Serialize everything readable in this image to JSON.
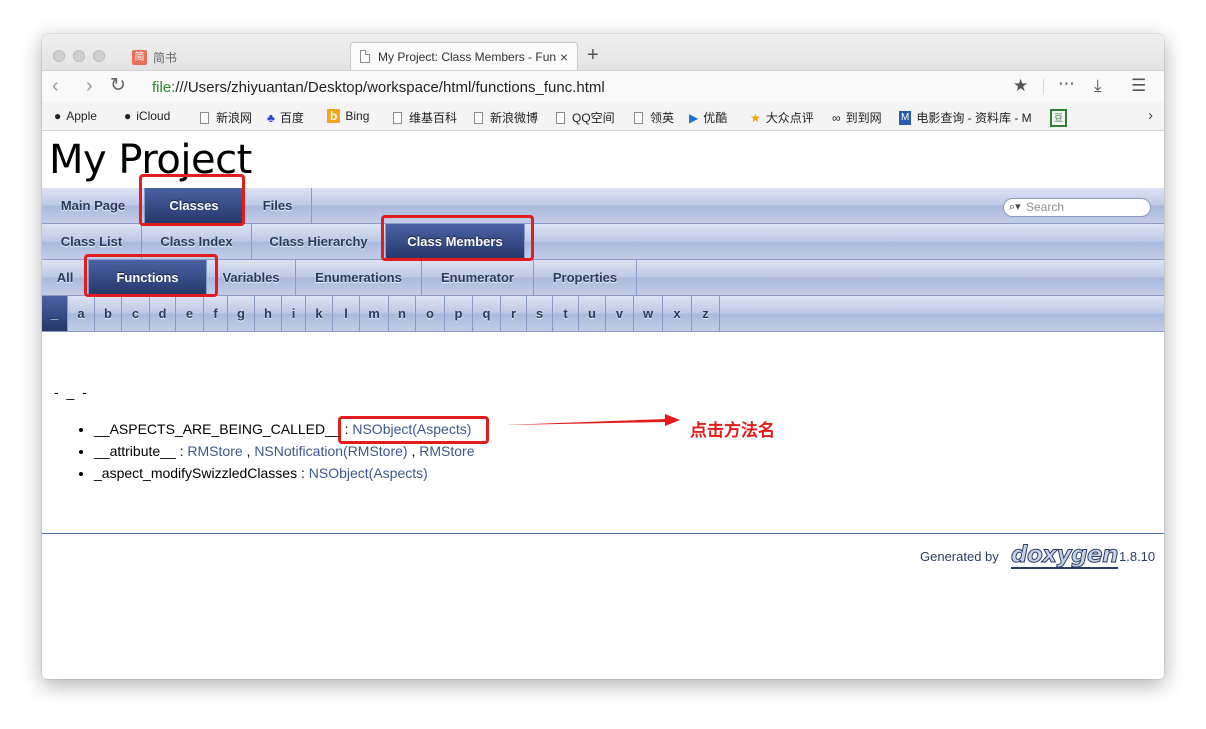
{
  "browser": {
    "tabs": [
      {
        "title": "简书",
        "icon_text": "简"
      },
      {
        "title": "My Project: Class Members - Function",
        "close": "×"
      }
    ],
    "new_tab": "+",
    "url_scheme": "file:",
    "url_path": "///Users/zhiyuantan/Desktop/workspace/html/functions_func.html",
    "icons": {
      "back": "back-icon",
      "forward": "forward-icon",
      "reload": "reload-icon",
      "bookmark": "star-icon",
      "more": "more-icon",
      "download": "download-icon",
      "menu": "hamburger-icon"
    },
    "bookmarks": [
      "Apple",
      "iCloud",
      "新浪网",
      "百度",
      "Bing",
      "维基百科",
      "新浪微博",
      "QQ空间",
      "领英",
      "优酷",
      "大众点评",
      "到到网",
      "电影查询 - 资料库 - M",
      ""
    ],
    "bookmarks_more": "›"
  },
  "doxygen": {
    "project_name": "My Project",
    "nav_main": [
      "Main Page",
      "Classes",
      "Files"
    ],
    "search_placeholder": "Search",
    "nav_classes": [
      "Class List",
      "Class Index",
      "Class Hierarchy",
      "Class Members"
    ],
    "nav_members": [
      "All",
      "Functions",
      "Variables",
      "Enumerations",
      "Enumerator",
      "Properties"
    ],
    "letters": [
      "_",
      "a",
      "b",
      "c",
      "d",
      "e",
      "f",
      "g",
      "h",
      "i",
      "k",
      "l",
      "m",
      "n",
      "o",
      "p",
      "q",
      "r",
      "s",
      "t",
      "u",
      "v",
      "w",
      "x",
      "z"
    ],
    "section_heading": "- _ -",
    "members": [
      {
        "name": "__ASPECTS_ARE_BEING_CALLED__",
        "sep": " : ",
        "links": [
          "NSObject(Aspects)"
        ]
      },
      {
        "name": "__attribute__",
        "sep": " : ",
        "links": [
          "RMStore",
          "NSNotification(RMStore)",
          "RMStore"
        ]
      },
      {
        "name": "_aspect_modifySwizzledClasses",
        "sep": " : ",
        "links": [
          "NSObject(Aspects)"
        ]
      }
    ],
    "link_separator": " , ",
    "footer": {
      "generated_by": "Generated by",
      "logo": "doxygen",
      "version": "1.8.10"
    }
  },
  "annotation": "点击方法名",
  "colors": {
    "annotation_red": "#e21b1b",
    "nav_current": "#25386a",
    "link": "#3d578c"
  }
}
